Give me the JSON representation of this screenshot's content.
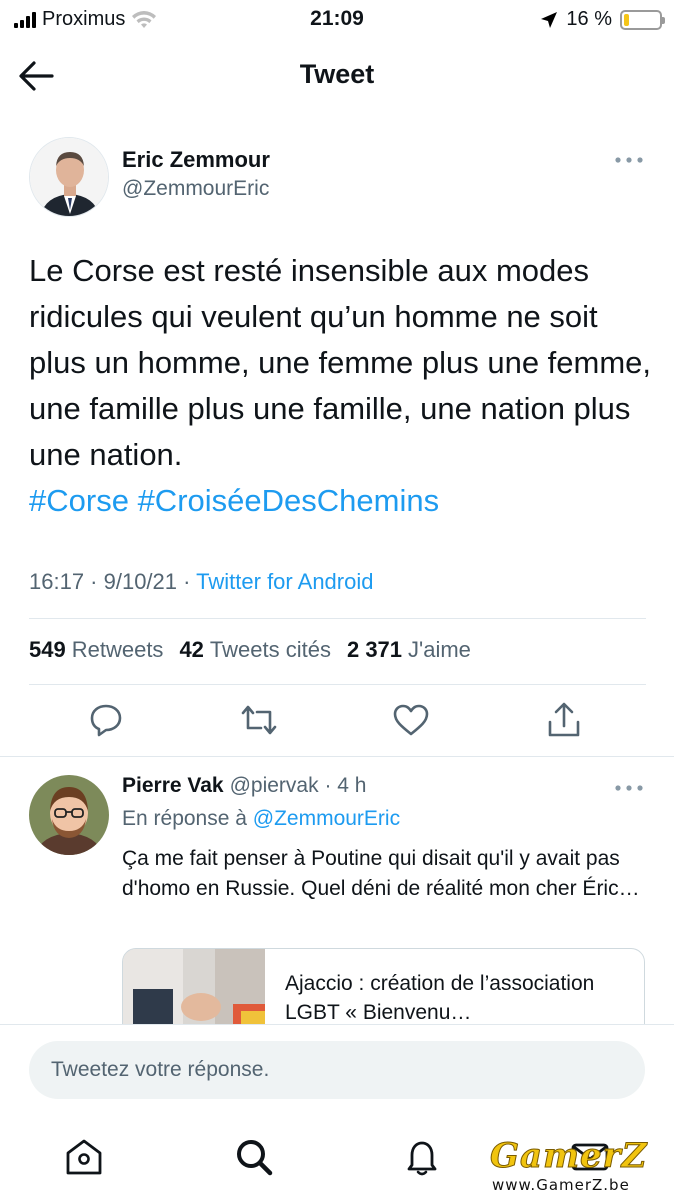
{
  "status_bar": {
    "carrier": "Proximus",
    "time": "21:09",
    "battery_percent": "16 %",
    "battery_level": 0.16
  },
  "header": {
    "title": "Tweet"
  },
  "tweet": {
    "author_name": "Eric Zemmour",
    "author_handle": "@ZemmourEric",
    "text": "Le Corse est resté insensible aux modes ridicules qui veulent qu’un homme ne soit plus un homme, une femme plus une femme, une famille plus une famille, une nation plus une nation.",
    "hashtags": [
      "#Corse",
      "#CroiséeDesChemins"
    ],
    "timestamp": "16:17 · 9/10/21 · ",
    "source": "Twitter for Android",
    "stats": {
      "retweets_count": "549",
      "retweets_label": "Retweets",
      "quotes_count": "42",
      "quotes_label": "Tweets cités",
      "likes_count": "2 371",
      "likes_label": "J'aime"
    },
    "actions": [
      "reply-icon",
      "retweet-icon",
      "like-icon",
      "share-icon"
    ]
  },
  "reply": {
    "author_name": "Pierre Vak",
    "author_handle_time": "@piervak · 4 h",
    "reply_to_label": "En réponse à ",
    "reply_to_mention": "@ZemmourEric",
    "text": "Ça me fait penser à Poutine qui disait qu'il y avait pas d'homo en Russie. Quel déni de réalité mon cher Éric…",
    "link_card_title": "Ajaccio : création de l’association LGBT « Bienvenu…"
  },
  "composer": {
    "placeholder": "Tweetez votre réponse."
  },
  "bottom_nav": [
    "home-icon",
    "search-icon",
    "notifications-icon",
    "messages-icon"
  ],
  "watermark": {
    "logo": "GamerZ",
    "url": "www.GamerZ.be"
  },
  "colors": {
    "accent": "#1d9bf0",
    "text_primary": "#0f1419",
    "text_secondary": "#536471",
    "divider": "#e1e8ed",
    "battery_low": "#f5c518"
  }
}
